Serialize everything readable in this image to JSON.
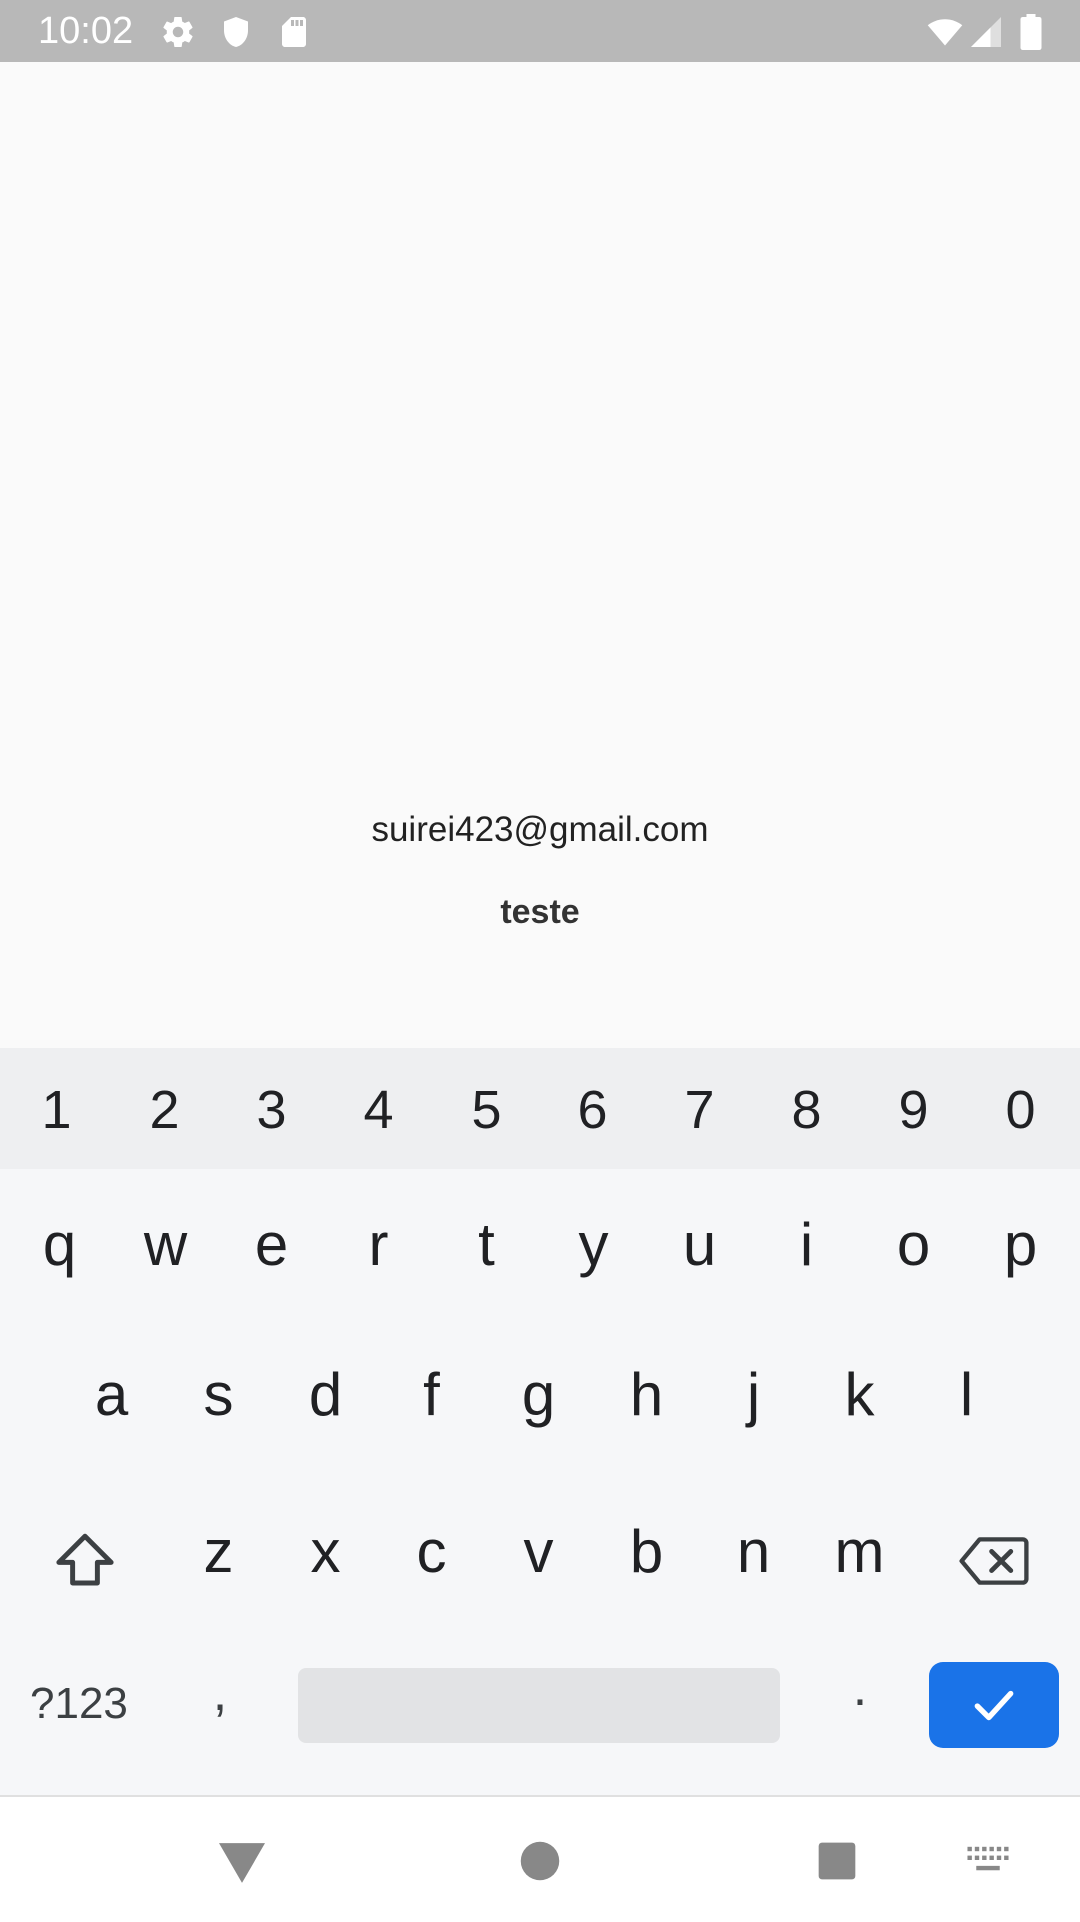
{
  "status_bar": {
    "time": "10:02",
    "icons": [
      "gear-icon",
      "shield-icon",
      "sd-card-icon",
      "wifi-icon",
      "signal-icon",
      "battery-icon"
    ]
  },
  "content": {
    "email": "suirei423@gmail.com",
    "name": "teste"
  },
  "keyboard": {
    "number_row": [
      "1",
      "2",
      "3",
      "4",
      "5",
      "6",
      "7",
      "8",
      "9",
      "0"
    ],
    "row_1": [
      "q",
      "w",
      "e",
      "r",
      "t",
      "y",
      "u",
      "i",
      "o",
      "p"
    ],
    "row_2": [
      "a",
      "s",
      "d",
      "f",
      "g",
      "h",
      "j",
      "k",
      "l"
    ],
    "row_3": [
      "z",
      "x",
      "c",
      "v",
      "b",
      "n",
      "m"
    ],
    "symbols_label": "?123",
    "comma_label": ",",
    "period_label": ".",
    "enter_icon": "check-icon",
    "shift_icon": "shift-icon",
    "backspace_icon": "backspace-icon"
  },
  "nav_bar": {
    "icons": [
      "back-icon",
      "home-icon",
      "recents-icon",
      "keyboard-switch-icon"
    ]
  },
  "colors": {
    "status_bar": "#b8b8b8",
    "accent": "#1a73e8",
    "keyboard_bg": "#f6f7f9",
    "number_row_bg": "#eeeff1"
  }
}
